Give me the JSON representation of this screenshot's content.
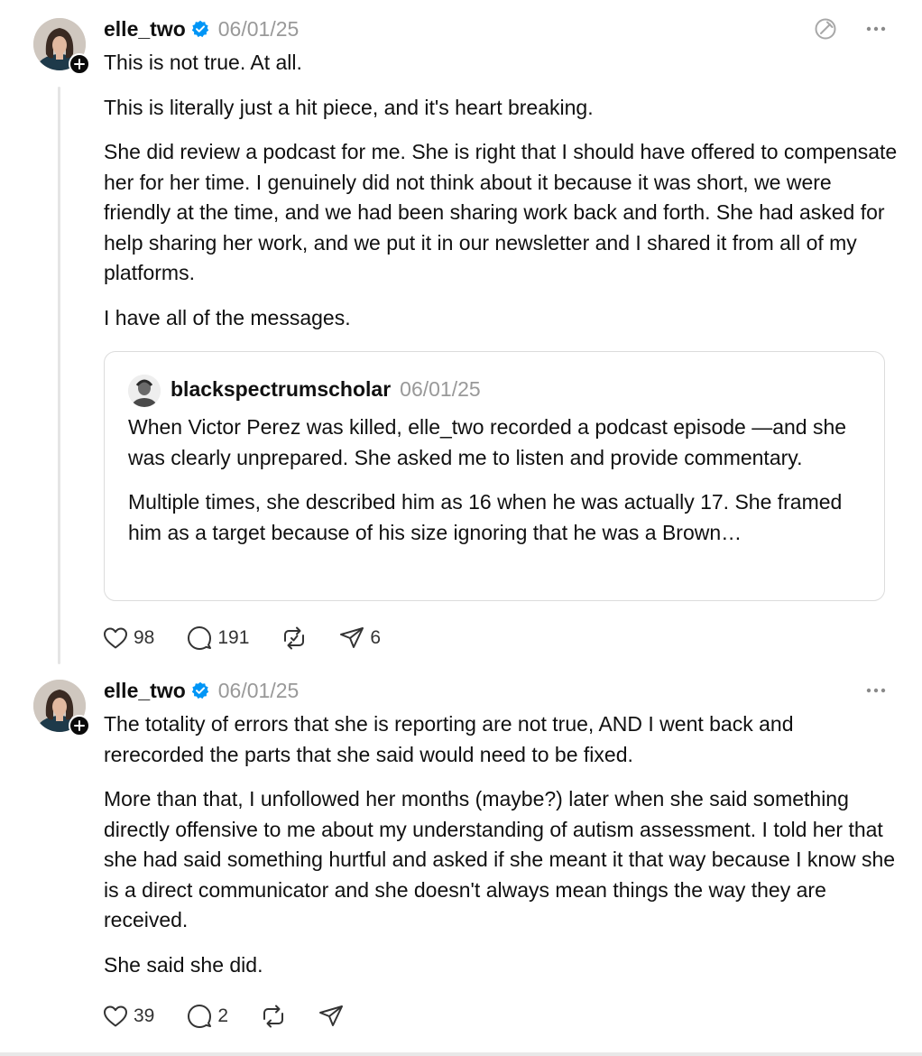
{
  "posts": [
    {
      "username": "elle_two",
      "date": "06/01/25",
      "paragraphs": [
        "This is not true. At all.",
        "This is literally just a hit piece, and it's heart breaking.",
        "She did review a podcast for me. She is right that I should have offered to compensate her for her time. I genuinely did not think about it because it was short, we were friendly at the time, and we had been sharing work back and forth. She had asked for help sharing her work, and we put it in our newsletter and I shared it from all of my platforms.",
        "I have all of the messages."
      ],
      "quote": {
        "username": "blackspectrumscholar",
        "date": "06/01/25",
        "paragraphs": [
          "When Victor Perez was killed, elle_two recorded a podcast episode —and she was clearly unprepared. She asked me to listen and provide commentary.",
          "Multiple times, she described him as 16 when he was actually 17. She framed him as a target because of his size ignoring that he was a Brown…"
        ]
      },
      "likes": "98",
      "replies": "191",
      "shares": "6"
    },
    {
      "username": "elle_two",
      "date": "06/01/25",
      "paragraphs": [
        "The totality of errors that she is reporting are not true, AND I went back and rerecorded the parts that she said would need to be fixed.",
        "More than that, I unfollowed her months (maybe?) later when she said something directly offensive to me about my understanding of autism assessment. I told her that she had said something hurtful and asked if she meant it that way because I know she is a direct communicator and she doesn't always mean things the way they are received.",
        "She said she did."
      ],
      "likes": "39",
      "replies": "2"
    }
  ],
  "icons": {
    "verified": "verified-badge-icon",
    "like": "heart-icon",
    "reply": "comment-icon",
    "repost": "repost-icon",
    "share": "send-icon",
    "more": "more-icon",
    "summarize": "summarize-icon",
    "follow": "plus-icon"
  },
  "colors": {
    "verified": "#0095f6",
    "muted": "#999999",
    "text": "#101010"
  }
}
